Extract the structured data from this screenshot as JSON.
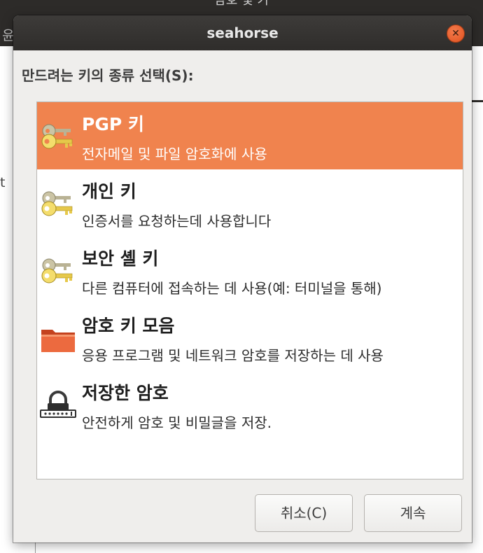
{
  "background_window": {
    "title": "암호 및 키",
    "left_fragment_1": "윤",
    "left_fragment_2": "t"
  },
  "dialog": {
    "title": "seahorse",
    "close_symbol": "✕",
    "prompt": "만드려는 키의 종류 선택(S):",
    "items": [
      {
        "name": "PGP 키",
        "description": "전자메일 및 파일 암호화에 사용",
        "icon": "keys-icon",
        "selected": true
      },
      {
        "name": "개인 키",
        "description": "인증서를 요청하는데 사용합니다",
        "icon": "keys-icon",
        "selected": false
      },
      {
        "name": "보안 셸 키",
        "description": "다른 컴퓨터에 접속하는 데 사용(예: 터미널을 통해)",
        "icon": "keys-icon",
        "selected": false
      },
      {
        "name": "암호 키 모음",
        "description": "응용 프로그램 및 네트워크 암호를 저장하는 데 사용",
        "icon": "folder-icon",
        "selected": false
      },
      {
        "name": "저장한 암호",
        "description": "안전하게 암호 및 비밀글을 저장.",
        "icon": "password-lock-icon",
        "selected": false
      }
    ],
    "buttons": {
      "cancel": "취소(C)",
      "continue": "계속"
    }
  },
  "colors": {
    "selection": "#f0834e",
    "titlebar": "#2f2d2b",
    "close_button": "#e0511f"
  }
}
